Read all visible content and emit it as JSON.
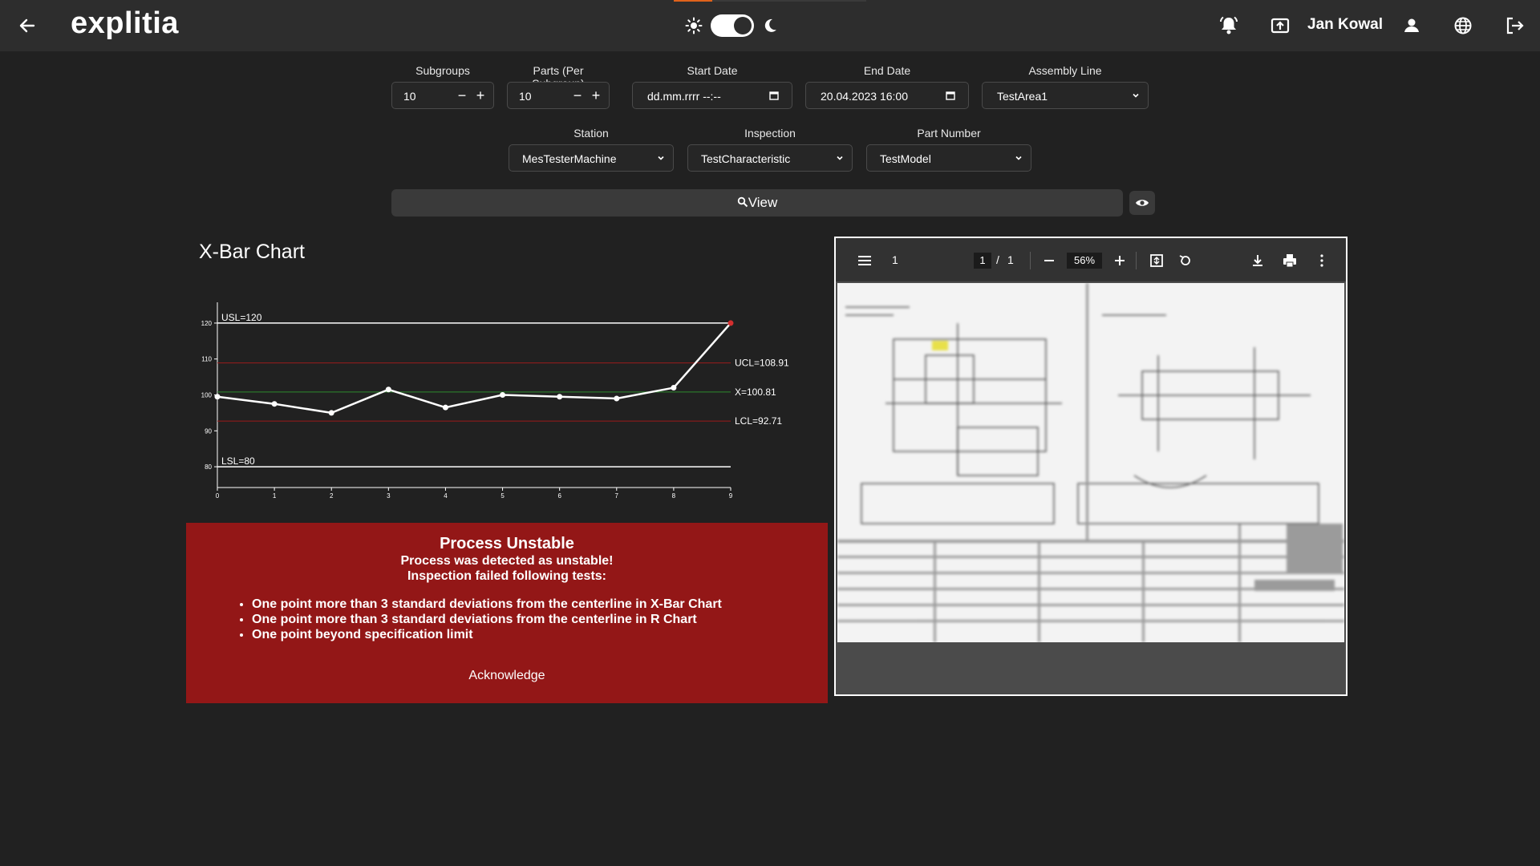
{
  "header": {
    "logo": "explitia",
    "user_name": "Jan Kowal",
    "icons": [
      "arrow-left-icon",
      "sun-icon",
      "moon-icon",
      "bell-icon",
      "upload-icon",
      "user-icon",
      "globe-icon",
      "logout-icon"
    ],
    "accent_color": "#e0621b"
  },
  "filters": {
    "subgroups": {
      "label": "Subgroups",
      "value": "10"
    },
    "parts": {
      "label": "Parts (Per Subgroup)",
      "value": "10"
    },
    "start_date": {
      "label": "Start Date",
      "value": "dd.mm.rrrr --:--"
    },
    "end_date": {
      "label": "End Date",
      "value": "20.04.2023 16:00"
    },
    "assembly_line": {
      "label": "Assembly Line",
      "value": "TestArea1"
    },
    "station": {
      "label": "Station",
      "value": "MesTesterMachine"
    },
    "inspection": {
      "label": "Inspection",
      "value": "TestCharacteristic"
    },
    "part_number": {
      "label": "Part Number",
      "value": "TestModel"
    },
    "view_label": "View"
  },
  "chart": {
    "title": "X-Bar Chart"
  },
  "chart_data": {
    "type": "line",
    "title": "X-Bar Chart",
    "x": [
      0,
      1,
      2,
      3,
      4,
      5,
      6,
      7,
      8,
      9
    ],
    "series": [
      {
        "values": [
          99.5,
          97.5,
          95,
          101.5,
          96.5,
          100,
          99.5,
          99,
          102,
          120
        ]
      }
    ],
    "reference_lines": [
      {
        "label": "USL=120",
        "value": 120,
        "color": "#ffffff"
      },
      {
        "label": "UCL=108.91",
        "value": 108.91,
        "color": "#9b1b1b"
      },
      {
        "label": "X=100.81",
        "value": 100.81,
        "color": "#2e8b2e"
      },
      {
        "label": "LCL=92.71",
        "value": 92.71,
        "color": "#9b1b1b"
      },
      {
        "label": "LSL=80",
        "value": 80,
        "color": "#ffffff"
      }
    ],
    "x_ticks": [
      "0",
      "1",
      "2",
      "3",
      "4",
      "5",
      "6",
      "7",
      "8",
      "9"
    ],
    "y_ticks": [
      "80",
      "90",
      "100",
      "110",
      "120"
    ],
    "xlim": [
      0,
      9
    ],
    "ylim": [
      76,
      124
    ],
    "highlight_color": "#d32f2f",
    "grid": false
  },
  "alert": {
    "title": "Process Unstable",
    "line1": "Process was detected as unstable!",
    "line2": "Inspection failed following tests:",
    "items": [
      "One point more than 3 standard deviations from the centerline in X-Bar Chart",
      "One point more than 3 standard deviations from the centerline in R Chart",
      "One point beyond specification limit"
    ],
    "acknowledge": "Acknowledge",
    "color": "#931717"
  },
  "pdf": {
    "page_label": "1",
    "page_current": "1",
    "page_sep": "/",
    "page_total": "1",
    "zoom": "56%"
  }
}
